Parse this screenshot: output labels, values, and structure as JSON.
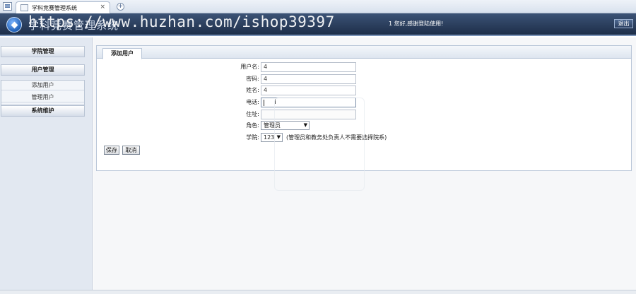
{
  "browser": {
    "tab_title": "学科竞赛管理系统",
    "tab_close": "×",
    "new_tab": "+"
  },
  "header": {
    "title": "学科竞赛管理系统",
    "welcome": "1 您好,感谢登陆使用!",
    "logout_label": "退出",
    "watermark": "https://www.huzhan.com/ishop39397"
  },
  "sidebar": {
    "groups": [
      {
        "label": "学院管理"
      },
      {
        "label": "用户管理",
        "items": [
          {
            "label": "添加用户"
          },
          {
            "label": "管理用户"
          }
        ]
      },
      {
        "label": "系统维护"
      }
    ]
  },
  "main": {
    "tab_label": "添加用户",
    "form": {
      "username": {
        "label": "用户名:",
        "value": "4"
      },
      "password": {
        "label": "密码:",
        "value": "4"
      },
      "name": {
        "label": "姓名:",
        "value": "4"
      },
      "phone": {
        "label": "电话:",
        "value": ""
      },
      "address": {
        "label": "住址:",
        "value": ""
      },
      "role": {
        "label": "角色:",
        "value": "管理员"
      },
      "college": {
        "label": "学院:",
        "value": "123",
        "hint": "(管理员和教务处负责人不需要选择院系)"
      }
    },
    "save_label": "保存",
    "cancel_label": "取消"
  }
}
